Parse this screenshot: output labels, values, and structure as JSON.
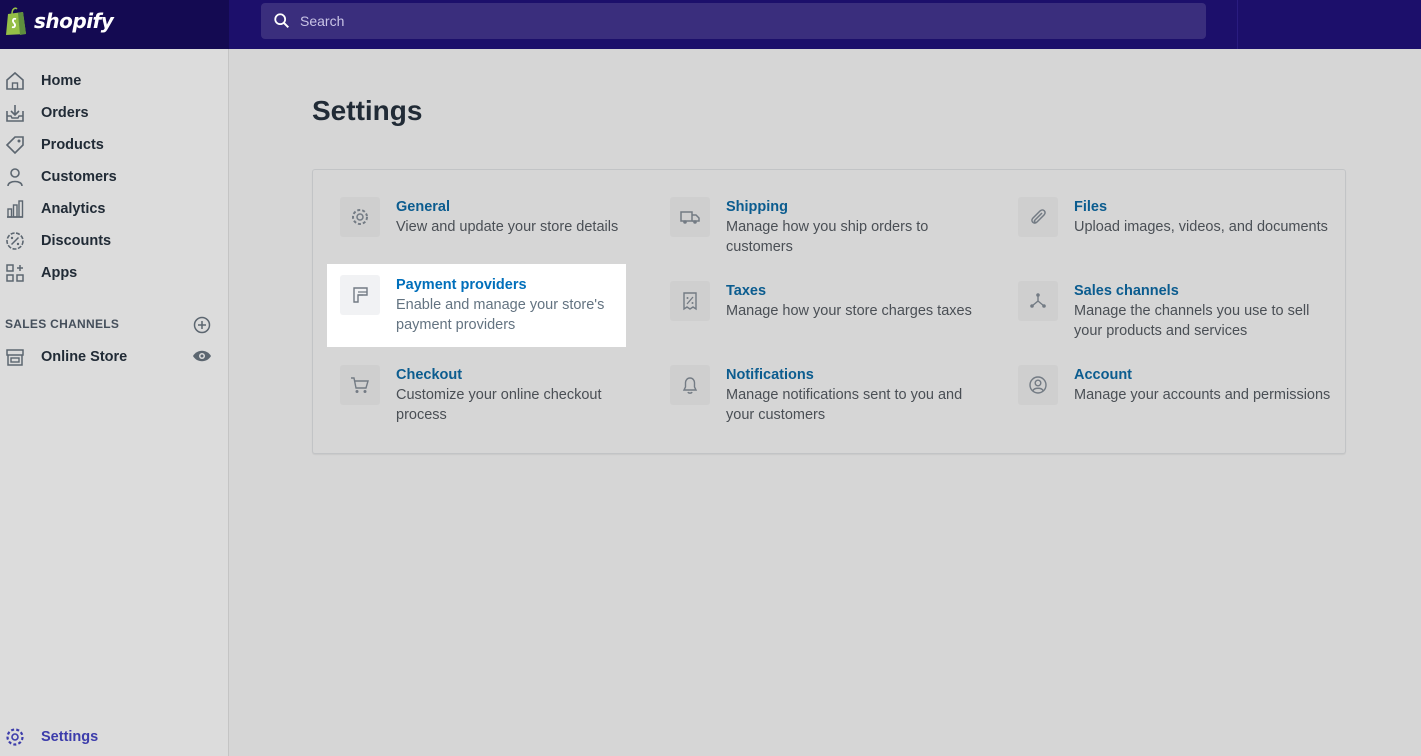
{
  "app": {
    "brand": "shopify"
  },
  "search": {
    "placeholder": "Search"
  },
  "sidebar": {
    "items": [
      {
        "label": "Home",
        "icon": "home-icon"
      },
      {
        "label": "Orders",
        "icon": "orders-icon"
      },
      {
        "label": "Products",
        "icon": "tag-icon"
      },
      {
        "label": "Customers",
        "icon": "person-icon"
      },
      {
        "label": "Analytics",
        "icon": "bar-chart-icon"
      },
      {
        "label": "Discounts",
        "icon": "discount-icon"
      },
      {
        "label": "Apps",
        "icon": "apps-icon"
      }
    ],
    "sales_channels_heading": "SALES CHANNELS",
    "online_store": "Online Store",
    "settings": "Settings"
  },
  "main": {
    "title": "Settings",
    "tiles": [
      {
        "title": "General",
        "desc": "View and update your store details",
        "icon": "gear-icon"
      },
      {
        "title": "Shipping",
        "desc": "Manage how you ship orders to customers",
        "icon": "truck-icon"
      },
      {
        "title": "Files",
        "desc": "Upload images, videos, and documents",
        "icon": "paperclip-icon"
      },
      {
        "title": "Payment providers",
        "desc": "Enable and manage your store's payment providers",
        "icon": "payment-icon"
      },
      {
        "title": "Taxes",
        "desc": "Manage how your store charges taxes",
        "icon": "receipt-icon"
      },
      {
        "title": "Sales channels",
        "desc": "Manage the channels you use to sell your products and services",
        "icon": "channels-icon"
      },
      {
        "title": "Checkout",
        "desc": "Customize your online checkout process",
        "icon": "cart-icon"
      },
      {
        "title": "Notifications",
        "desc": "Manage notifications sent to you and your customers",
        "icon": "bell-icon"
      },
      {
        "title": "Account",
        "desc": "Manage your accounts and permissions",
        "icon": "account-icon"
      }
    ]
  },
  "colors": {
    "topbar": "#1c0f6b",
    "link": "#0b5c8f",
    "highlight_link": "#006fbb"
  }
}
